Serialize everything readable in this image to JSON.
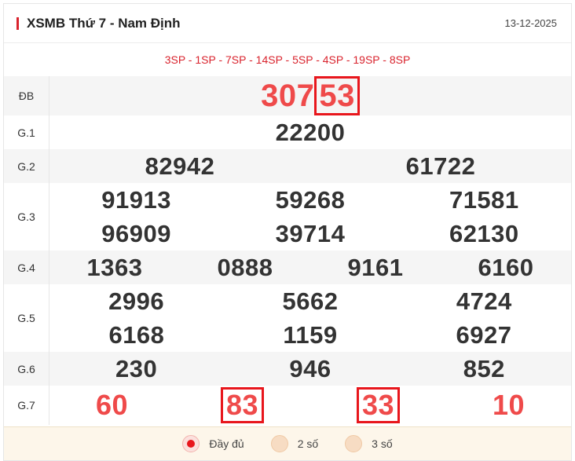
{
  "header": {
    "title": "XSMB Thứ 7 - Nam Định",
    "date": "13-12-2025"
  },
  "codes": "3SP - 1SP - 7SP - 14SP - 5SP - 4SP - 19SP - 8SP",
  "prizes": {
    "db": {
      "label": "ĐB",
      "prefix": "307",
      "tail": "53"
    },
    "g1": {
      "label": "G.1",
      "numbers": [
        "22200"
      ]
    },
    "g2": {
      "label": "G.2",
      "numbers": [
        "82942",
        "61722"
      ]
    },
    "g3": {
      "label": "G.3",
      "numbers": [
        "91913",
        "59268",
        "71581",
        "96909",
        "39714",
        "62130"
      ]
    },
    "g4": {
      "label": "G.4",
      "numbers": [
        "1363",
        "0888",
        "9161",
        "6160"
      ]
    },
    "g5": {
      "label": "G.5",
      "numbers": [
        "2996",
        "5662",
        "4724",
        "6168",
        "1159",
        "6927"
      ]
    },
    "g6": {
      "label": "G.6",
      "numbers": [
        "230",
        "946",
        "852"
      ]
    },
    "g7": {
      "label": "G.7",
      "numbers": [
        "60",
        "83",
        "33",
        "10"
      ]
    }
  },
  "filters": [
    {
      "label": "Đầy đủ",
      "selected": true
    },
    {
      "label": "2 số",
      "selected": false
    },
    {
      "label": "3 số",
      "selected": false
    }
  ]
}
